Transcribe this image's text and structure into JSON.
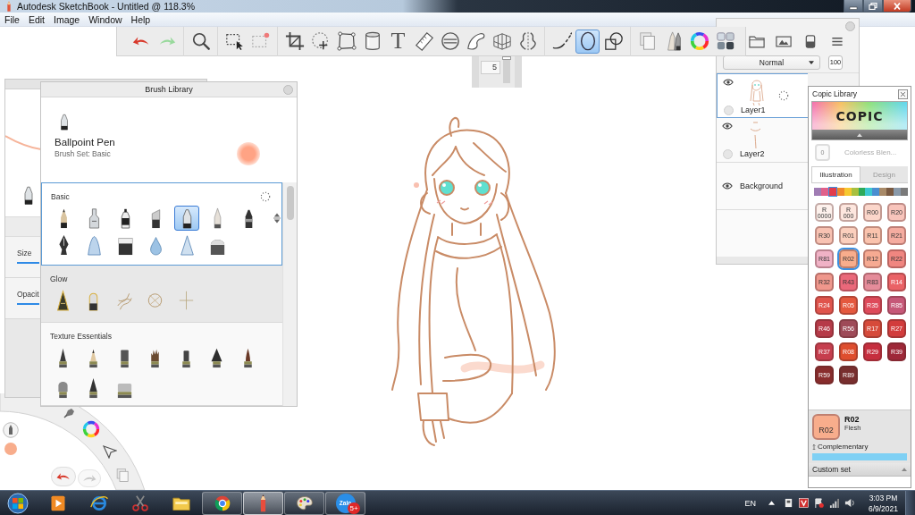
{
  "window": {
    "title": "Autodesk SketchBook - Untitled @ 118.3%"
  },
  "menu": [
    "File",
    "Edit",
    "Image",
    "Window",
    "Help"
  ],
  "toolbar": {
    "groups": [
      {
        "tools": [
          {
            "kind": "undo",
            "selected": false
          },
          {
            "kind": "redo",
            "selected": false
          }
        ]
      },
      {
        "tools": [
          {
            "kind": "zoom",
            "selected": false
          }
        ]
      },
      {
        "tools": [
          {
            "kind": "select",
            "selected": false
          },
          {
            "kind": "select-clear",
            "selected": false
          }
        ]
      },
      {
        "tools": [
          {
            "kind": "crop",
            "selected": false
          },
          {
            "kind": "transform",
            "selected": false
          },
          {
            "kind": "distort",
            "selected": false
          },
          {
            "kind": "fill",
            "selected": false
          },
          {
            "kind": "text",
            "label": "T",
            "selected": false
          },
          {
            "kind": "ruler",
            "selected": false
          },
          {
            "kind": "ellipse-guide",
            "selected": false
          },
          {
            "kind": "french-curve",
            "selected": false
          },
          {
            "kind": "perspective",
            "selected": false
          },
          {
            "kind": "symmetry",
            "selected": false
          }
        ]
      },
      {
        "tools": [
          {
            "kind": "stroke",
            "selected": false
          },
          {
            "kind": "ellipse",
            "selected": true
          },
          {
            "kind": "shape",
            "selected": false
          }
        ]
      },
      {
        "tools": [
          {
            "kind": "copy",
            "selected": false
          },
          {
            "kind": "brushes",
            "selected": false
          },
          {
            "kind": "color-wheel",
            "selected": false
          },
          {
            "kind": "palette",
            "selected": false
          }
        ]
      }
    ]
  },
  "brush_size": {
    "value": "5",
    "level": 1
  },
  "brush_properties": {
    "sliders": [
      {
        "label": "Size"
      },
      {
        "label": "Opacit"
      }
    ]
  },
  "brush_library": {
    "title": "Brush Library",
    "brush_name": "Ballpoint Pen",
    "brush_set": "Brush Set: Basic",
    "sets": [
      {
        "name": "Basic",
        "selected": true,
        "brushes": [
          {
            "kind": "pencil",
            "selected": false
          },
          {
            "kind": "airbrush",
            "selected": false
          },
          {
            "kind": "marker",
            "selected": false
          },
          {
            "kind": "chisel",
            "selected": false
          },
          {
            "kind": "ballpoint",
            "selected": true
          },
          {
            "kind": "fine-brush",
            "selected": false
          },
          {
            "kind": "fineliner",
            "selected": false
          },
          {
            "kind": "nib",
            "selected": false
          },
          {
            "kind": "cone",
            "selected": false
          },
          {
            "kind": "block",
            "selected": false
          },
          {
            "kind": "drop",
            "selected": false
          },
          {
            "kind": "triangle",
            "selected": false
          },
          {
            "kind": "dome",
            "selected": false
          }
        ]
      },
      {
        "name": "Glow",
        "selected": false,
        "brushes": [
          {
            "kind": "glow-pen",
            "selected": false
          },
          {
            "kind": "glow-marker",
            "selected": false
          },
          {
            "kind": "glow-scribble",
            "selected": false
          },
          {
            "kind": "glow-ring",
            "selected": false
          },
          {
            "kind": "glow-spark",
            "selected": false
          }
        ]
      },
      {
        "name": "Texture Essentials",
        "selected": false,
        "brushes": [
          {
            "kind": "tex-cone",
            "selected": false
          },
          {
            "kind": "tex-pencil",
            "selected": false
          },
          {
            "kind": "tex-block",
            "selected": false
          },
          {
            "kind": "tex-bristle",
            "selected": false
          },
          {
            "kind": "tex-stick",
            "selected": false
          },
          {
            "kind": "tex-wide-cone",
            "selected": false
          },
          {
            "kind": "tex-brush",
            "selected": false
          },
          {
            "kind": "tex-dome",
            "selected": false
          },
          {
            "kind": "tex-tall-cone",
            "selected": false
          },
          {
            "kind": "tex-flat",
            "selected": false
          }
        ]
      }
    ]
  },
  "layers": {
    "blend_mode": "Normal",
    "opacity": "100",
    "items": [
      {
        "kind": "paint",
        "name": "Layer1",
        "selected": true,
        "visible": true
      },
      {
        "kind": "paint",
        "name": "Layer2",
        "selected": false,
        "visible": true
      },
      {
        "kind": "background",
        "name": "Background",
        "selected": false,
        "visible": true
      }
    ]
  },
  "copic": {
    "title": "Copic Library",
    "logo": "COPIC",
    "blender": {
      "code": "0",
      "name": "Colorless Blen..."
    },
    "tabs": [
      {
        "label": "Illustration",
        "selected": true
      },
      {
        "label": "Design",
        "selected": false
      }
    ],
    "families": [
      {
        "color": "#a07cb4",
        "selected": false
      },
      {
        "color": "#e0608a",
        "selected": false
      },
      {
        "color": "#e23c4c",
        "selected": true
      },
      {
        "color": "#f08a2c",
        "selected": false
      },
      {
        "color": "#f6c830",
        "selected": false
      },
      {
        "color": "#a8c040",
        "selected": false
      },
      {
        "color": "#2eaa5a",
        "selected": false
      },
      {
        "color": "#3cc8d0",
        "selected": false
      },
      {
        "color": "#4a8ed0",
        "selected": false
      },
      {
        "color": "#a88a68",
        "selected": false
      },
      {
        "color": "#7a5a42",
        "selected": false
      },
      {
        "color": "#8a9aaa",
        "selected": false
      },
      {
        "color": "#7a7a7a",
        "selected": false
      }
    ],
    "swatches": [
      {
        "code": "R 0000",
        "color": "#fdf1ec",
        "selected": false
      },
      {
        "code": "R 000",
        "color": "#fde6de",
        "selected": false
      },
      {
        "code": "R00",
        "color": "#fbd6ca",
        "selected": false
      },
      {
        "code": "R20",
        "color": "#f8c4bb",
        "selected": false
      },
      {
        "code": "R30",
        "color": "#f8c2b2",
        "selected": false
      },
      {
        "code": "R01",
        "color": "#fbcfbd",
        "selected": false
      },
      {
        "code": "R11",
        "color": "#fac3ad",
        "selected": false
      },
      {
        "code": "R21",
        "color": "#f5aca0",
        "selected": false
      },
      {
        "code": "R81",
        "color": "#f0b2c6",
        "selected": false
      },
      {
        "code": "R02",
        "color": "#f8ad8c",
        "selected": true
      },
      {
        "code": "R12",
        "color": "#f6aa92",
        "selected": false
      },
      {
        "code": "R22",
        "color": "#f08680",
        "selected": false
      },
      {
        "code": "R32",
        "color": "#ef978c",
        "selected": false
      },
      {
        "code": "R43",
        "color": "#ea687a",
        "selected": false
      },
      {
        "code": "R83",
        "color": "#e58c9a",
        "selected": false
      },
      {
        "code": "R14",
        "color": "#ea6266",
        "selected": false
      },
      {
        "code": "R24",
        "color": "#e0544c",
        "selected": false
      },
      {
        "code": "R05",
        "color": "#e4583e",
        "selected": false
      },
      {
        "code": "R35",
        "color": "#de4a5a",
        "selected": false
      },
      {
        "code": "R85",
        "color": "#c65878",
        "selected": false
      },
      {
        "code": "R46",
        "color": "#b63a48",
        "selected": false
      },
      {
        "code": "R56",
        "color": "#9e4a58",
        "selected": false
      },
      {
        "code": "R17",
        "color": "#d64a3a",
        "selected": false
      },
      {
        "code": "R27",
        "color": "#d23c3c",
        "selected": false
      },
      {
        "code": "R37",
        "color": "#c63e4e",
        "selected": false
      },
      {
        "code": "R08",
        "color": "#de4e2e",
        "selected": false
      },
      {
        "code": "R29",
        "color": "#c62e3e",
        "selected": false
      },
      {
        "code": "R39",
        "color": "#9e2838",
        "selected": false
      },
      {
        "code": "R59",
        "color": "#882c2c",
        "selected": false
      },
      {
        "code": "R89",
        "color": "#782e2e",
        "selected": false
      }
    ],
    "current": {
      "swatch": "R02",
      "code": "R02",
      "name": "Flesh"
    },
    "complementary": "Complementary",
    "custom_set": "Custom set"
  },
  "taskbar": {
    "apps": [
      {
        "kind": "media",
        "running": false,
        "selected": false
      },
      {
        "kind": "ie",
        "running": false,
        "selected": false
      },
      {
        "kind": "snipping",
        "running": false,
        "selected": false
      },
      {
        "kind": "explorer",
        "running": false,
        "selected": false
      },
      {
        "kind": "chrome",
        "running": true,
        "selected": false
      },
      {
        "kind": "sketchbook",
        "running": true,
        "selected": true
      },
      {
        "kind": "paint",
        "running": true,
        "selected": false
      },
      {
        "kind": "zalo",
        "label": "Zalo",
        "badge": "5+",
        "running": true,
        "selected": false
      }
    ],
    "language": "EN",
    "time": "3:03 PM",
    "date": "6/9/2021"
  }
}
